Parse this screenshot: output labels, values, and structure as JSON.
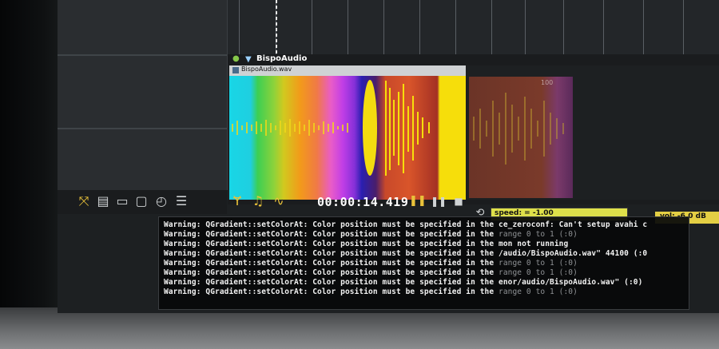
{
  "track": {
    "name": "BispoAudio",
    "clip_name": "BispoAudio.wav",
    "ghost_label": "100"
  },
  "toolbar": {
    "icons_left": [
      "fit-view-icon",
      "graph-icon",
      "folder-open-icon",
      "folder-icon",
      "history-icon",
      "list-icon"
    ],
    "icons_center": [
      "branch-icon",
      "music-notes-icon",
      "curve-icon"
    ],
    "timecode": "00:00:14.419",
    "speed_label": "speed: = -1.00",
    "vol_label": "vol: -6.0 dB"
  },
  "colors": {
    "accent": "#e9c23a",
    "speed_box": "#dfe14a",
    "vol_box": "#e4cf44",
    "waveform": "#e8d41a"
  },
  "console": {
    "lines": [
      {
        "left": "Warning: QGradient::setColorAt: Color position must be specified in the ",
        "right": "ce_zeroconf: Can't setup avahi c"
      },
      {
        "left": "Warning: QGradient::setColorAt: Color position must be specified in the ",
        "right": "range 0 to 1 (:0)"
      },
      {
        "left": "Warning: QGradient::setColorAt: Color position must be specified in the ",
        "right": "mon not running"
      },
      {
        "left": "Warning: QGradient::setColorAt: Color position must be specified in the ",
        "right": "/audio/BispoAudio.wav\" 44100 (:0"
      },
      {
        "left": "Warning: QGradient::setColorAt: Color position must be specified in the ",
        "right": "range 0 to 1 (:0)"
      },
      {
        "left": "Warning: QGradient::setColorAt: Color position must be specified in the ",
        "right": "range 0 to 1 (:0)"
      },
      {
        "left": "Warning: QGradient::setColorAt: Color position must be specified in the ",
        "right": "enor/audio/BispoAudio.wav\" (:0)"
      },
      {
        "left": "Warning: QGradient::setColorAt: Color position must be specified in the ",
        "right": "range 0 to 1 (:0)"
      }
    ]
  }
}
